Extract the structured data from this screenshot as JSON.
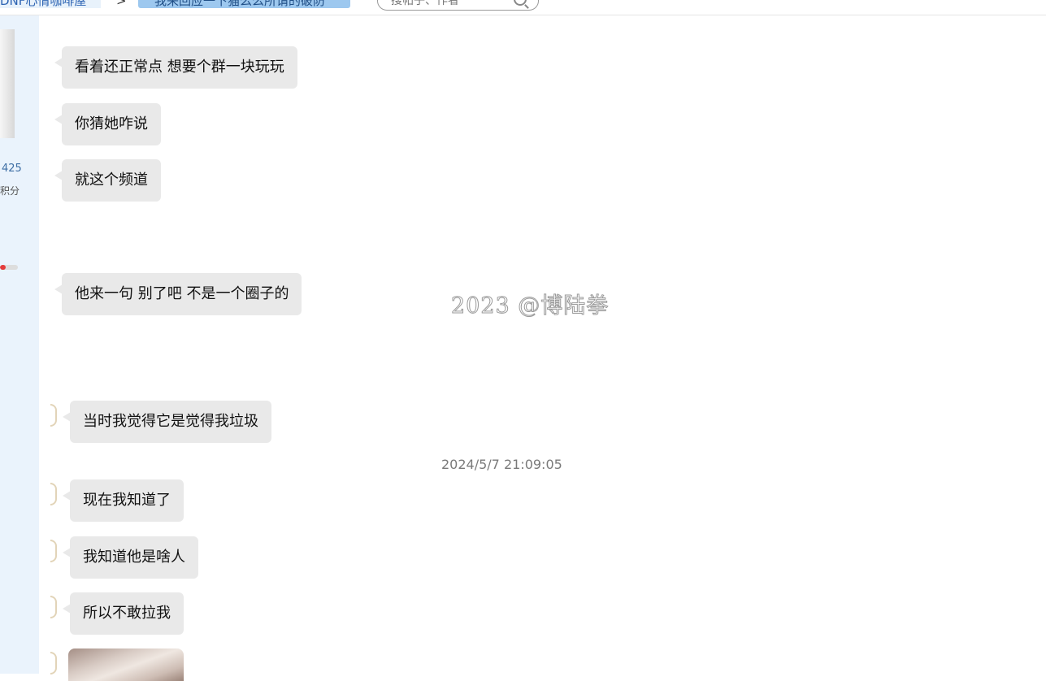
{
  "breadcrumb": {
    "forum": "DNF心情咖啡屋",
    "separator": ">",
    "thread": "我来回应一下猫么么所谓的破防"
  },
  "search": {
    "placeholder": "搜帖子、作者"
  },
  "sidebar": {
    "count_fragment": "425",
    "label_fragment": "积分",
    "level_progress": 0.3
  },
  "chat": {
    "messages": [
      {
        "text": "看着还正常点  想要个群一块玩玩"
      },
      {
        "text": "你猜她咋说"
      },
      {
        "text": "就这个频道"
      },
      {
        "text": "他来一句  别了吧 不是一个圈子的"
      },
      {
        "text": "当时我觉得它是觉得我垃圾"
      },
      {
        "text": "现在我知道了"
      },
      {
        "text": "我知道他是啥人"
      },
      {
        "text": "所以不敢拉我"
      }
    ],
    "timestamp": "2024/5/7 21:09:05",
    "watermark": "2023 @博陆拳"
  },
  "colors": {
    "bubble_bg": "#e9e9e9",
    "sidebar_bg": "#eaf3fc",
    "thread_tab_bg": "#9dc8ef",
    "link": "#2d64b3"
  }
}
